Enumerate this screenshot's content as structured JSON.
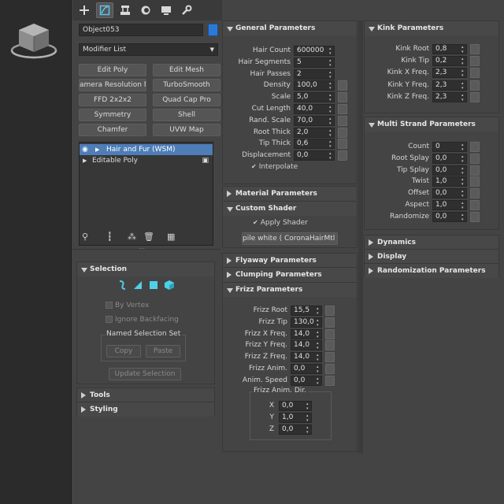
{
  "object_name": "Object053",
  "modifier_list": "Modifier List",
  "modifier_buttons": [
    "Edit Poly",
    "Edit Mesh",
    "amera Resolution Mo",
    "TurboSmooth",
    "FFD 2x2x2",
    "Quad Cap Pro",
    "Symmetry",
    "Shell",
    "Chamfer",
    "UVW Map"
  ],
  "stack": [
    "Hair and Fur (WSM)",
    "Editable Poly"
  ],
  "selection": {
    "title": "Selection",
    "by_vertex": "By Vertex",
    "ignore_backfacing": "Ignore Backfacing",
    "named_set": "Named Selection Set",
    "copy": "Copy",
    "paste": "Paste",
    "update": "Update Selection"
  },
  "tools": "Tools",
  "styling": "Styling",
  "general": {
    "title": "General Parameters",
    "rows": [
      {
        "label": "Hair Count",
        "value": "600000",
        "map": false
      },
      {
        "label": "Hair Segments",
        "value": "5",
        "map": false
      },
      {
        "label": "Hair Passes",
        "value": "2",
        "map": false
      },
      {
        "label": "Density",
        "value": "100,0",
        "map": true
      },
      {
        "label": "Scale",
        "value": "5,0",
        "map": true
      },
      {
        "label": "Cut Length",
        "value": "40,0",
        "map": true
      },
      {
        "label": "Rand. Scale",
        "value": "70,0",
        "map": true
      },
      {
        "label": "Root Thick",
        "value": "2,0",
        "map": true
      },
      {
        "label": "Tip Thick",
        "value": "0,6",
        "map": true
      },
      {
        "label": "Displacement",
        "value": "0,0",
        "map": true
      }
    ],
    "interpolate": "Interpolate"
  },
  "material": "Material Parameters",
  "custom_shader": {
    "title": "Custom Shader",
    "apply": "Apply Shader",
    "shader_btn": "pile white  ( CoronaHairMtl )"
  },
  "flyaway": "Flyaway Parameters",
  "clumping": "Clumping Parameters",
  "frizz": {
    "title": "Frizz Parameters",
    "rows": [
      {
        "label": "Frizz Root",
        "value": "15,5"
      },
      {
        "label": "Frizz Tip",
        "value": "130,0"
      },
      {
        "label": "Frizz X Freq.",
        "value": "14,0"
      },
      {
        "label": "Frizz Y Freq.",
        "value": "14,0"
      },
      {
        "label": "Frizz Z Freq.",
        "value": "14,0"
      },
      {
        "label": "Frizz Anim.",
        "value": "0,0"
      },
      {
        "label": "Anim. Speed",
        "value": "0,0"
      }
    ],
    "dir_title": "Frizz Anim. Dir.",
    "dir": [
      {
        "label": "X",
        "value": "0,0"
      },
      {
        "label": "Y",
        "value": "1,0"
      },
      {
        "label": "Z",
        "value": "0,0"
      }
    ]
  },
  "kink": {
    "title": "Kink Parameters",
    "rows": [
      {
        "label": "Kink Root",
        "value": "0,8"
      },
      {
        "label": "Kink Tip",
        "value": "0,2"
      },
      {
        "label": "Kink X Freq.",
        "value": "2,3"
      },
      {
        "label": "Kink Y Freq.",
        "value": "2,3"
      },
      {
        "label": "Kink Z Freq.",
        "value": "2,3"
      }
    ]
  },
  "multi": {
    "title": "Multi Strand Parameters",
    "rows": [
      {
        "label": "Count",
        "value": "0"
      },
      {
        "label": "Root Splay",
        "value": "0,0"
      },
      {
        "label": "Tip Splay",
        "value": "0,0"
      },
      {
        "label": "Twist",
        "value": "1,0"
      },
      {
        "label": "Offset",
        "value": "0,0"
      },
      {
        "label": "Aspect",
        "value": "1,0"
      },
      {
        "label": "Randomize",
        "value": "0,0"
      }
    ]
  },
  "dynamics": "Dynamics",
  "display": "Display",
  "randomization": "Randomization Parameters",
  "colors": {
    "accent": "#2c7ad6",
    "selected_row": "#4e7db8",
    "panel": "#444444"
  }
}
